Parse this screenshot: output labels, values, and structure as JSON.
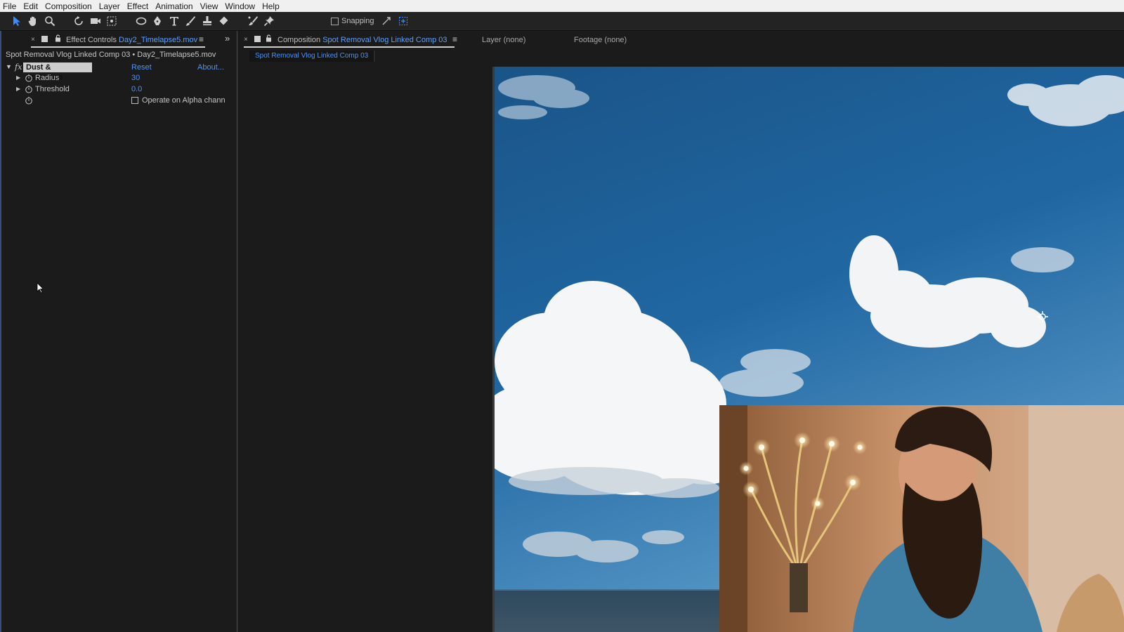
{
  "menu": [
    "File",
    "Edit",
    "Composition",
    "Layer",
    "Effect",
    "Animation",
    "View",
    "Window",
    "Help"
  ],
  "toolbar": {
    "tools": [
      "selection-tool-icon",
      "hand-tool-icon",
      "zoom-tool-icon",
      "rotate-tool-icon",
      "camera-tool-icon",
      "pan-behind-tool-icon",
      "ellipse-tool-icon",
      "pen-tool-icon",
      "type-tool-icon",
      "brush-tool-icon",
      "clone-stamp-tool-icon",
      "eraser-tool-icon",
      "roto-brush-tool-icon",
      "puppet-pin-tool-icon"
    ],
    "snapping_label": "Snapping"
  },
  "effect_controls": {
    "tab_prefix": "Effect Controls",
    "tab_layer": "Day2_Timelapse5.mov",
    "layer_path": "Spot Removal Vlog Linked Comp 03 • Day2_Timelapse5.mov",
    "effect_name": "Dust & Scratches",
    "fx_glyph": "fx",
    "reset_label": "Reset",
    "about_label": "About...",
    "properties": [
      {
        "name": "Radius",
        "value": "30"
      },
      {
        "name": "Threshold",
        "value": "0.0"
      }
    ],
    "checkbox_label": "Operate on Alpha chann"
  },
  "composition": {
    "tab_prefix": "Composition",
    "tab_comp": "Spot Removal Vlog Linked Comp 03",
    "layer_tab": "Layer  (none)",
    "footage_tab": "Footage  (none)",
    "breadcrumb": "Spot Removal Vlog Linked Comp 03"
  },
  "colors": {
    "accent_blue": "#4a94ff",
    "panel_bg": "#1b1b1b",
    "sky_blue": "#1d5e94"
  }
}
